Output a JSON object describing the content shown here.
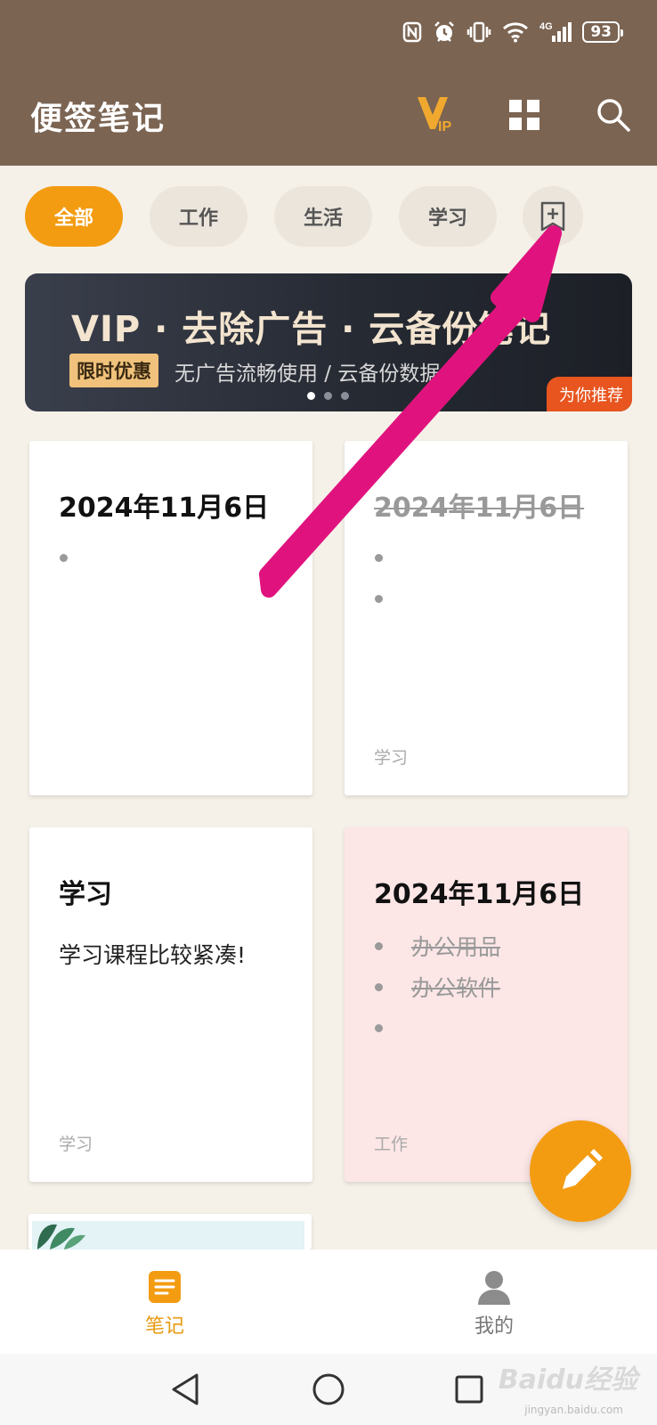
{
  "status_bar": {
    "icons": [
      "nfc-icon",
      "alarm-icon",
      "vibrate-icon",
      "wifi-icon",
      "signal-4g-icon"
    ],
    "network": "4G",
    "battery": "93"
  },
  "header": {
    "title": "便签笔记",
    "vip_label": "VIP",
    "accent": "#7b6452"
  },
  "categories": {
    "items": [
      "全部",
      "工作",
      "生活",
      "学习"
    ],
    "active_index": 0,
    "active_color": "#f39c12"
  },
  "banner": {
    "title": "VIP · 去除广告 · 云备份笔记",
    "tag": "限时优惠",
    "subtitle": "无广告流畅使用 / 云备份数据",
    "badge": "为你推荐",
    "slide_count": 3,
    "active_slide": 0
  },
  "notes": [
    {
      "title": "2024年11月6日",
      "completed_title": false,
      "bullets": [
        ""
      ],
      "body": "",
      "tag": "",
      "color": "#ffffff"
    },
    {
      "title": "2024年11月6日",
      "completed_title": true,
      "bullets": [
        "",
        ""
      ],
      "body": "",
      "tag": "学习",
      "color": "#ffffff"
    },
    {
      "title": "学习",
      "completed_title": false,
      "bullets": [],
      "body": "学习课程比较紧凑!",
      "tag": "学习",
      "color": "#ffffff"
    },
    {
      "title": "2024年11月6日",
      "completed_title": false,
      "bullets": [
        "办公用品",
        "办公软件",
        ""
      ],
      "body": "",
      "tag": "工作",
      "color": "#fde6e6"
    }
  ],
  "bottom_nav": {
    "items": [
      {
        "label": "笔记",
        "icon": "note-icon",
        "active": true
      },
      {
        "label": "我的",
        "icon": "profile-icon",
        "active": false
      }
    ]
  },
  "system_nav": [
    "back-icon",
    "home-icon",
    "recents-icon"
  ],
  "watermark": {
    "text": "Baidu经验",
    "url_text": "jingyan.baidu.com"
  }
}
